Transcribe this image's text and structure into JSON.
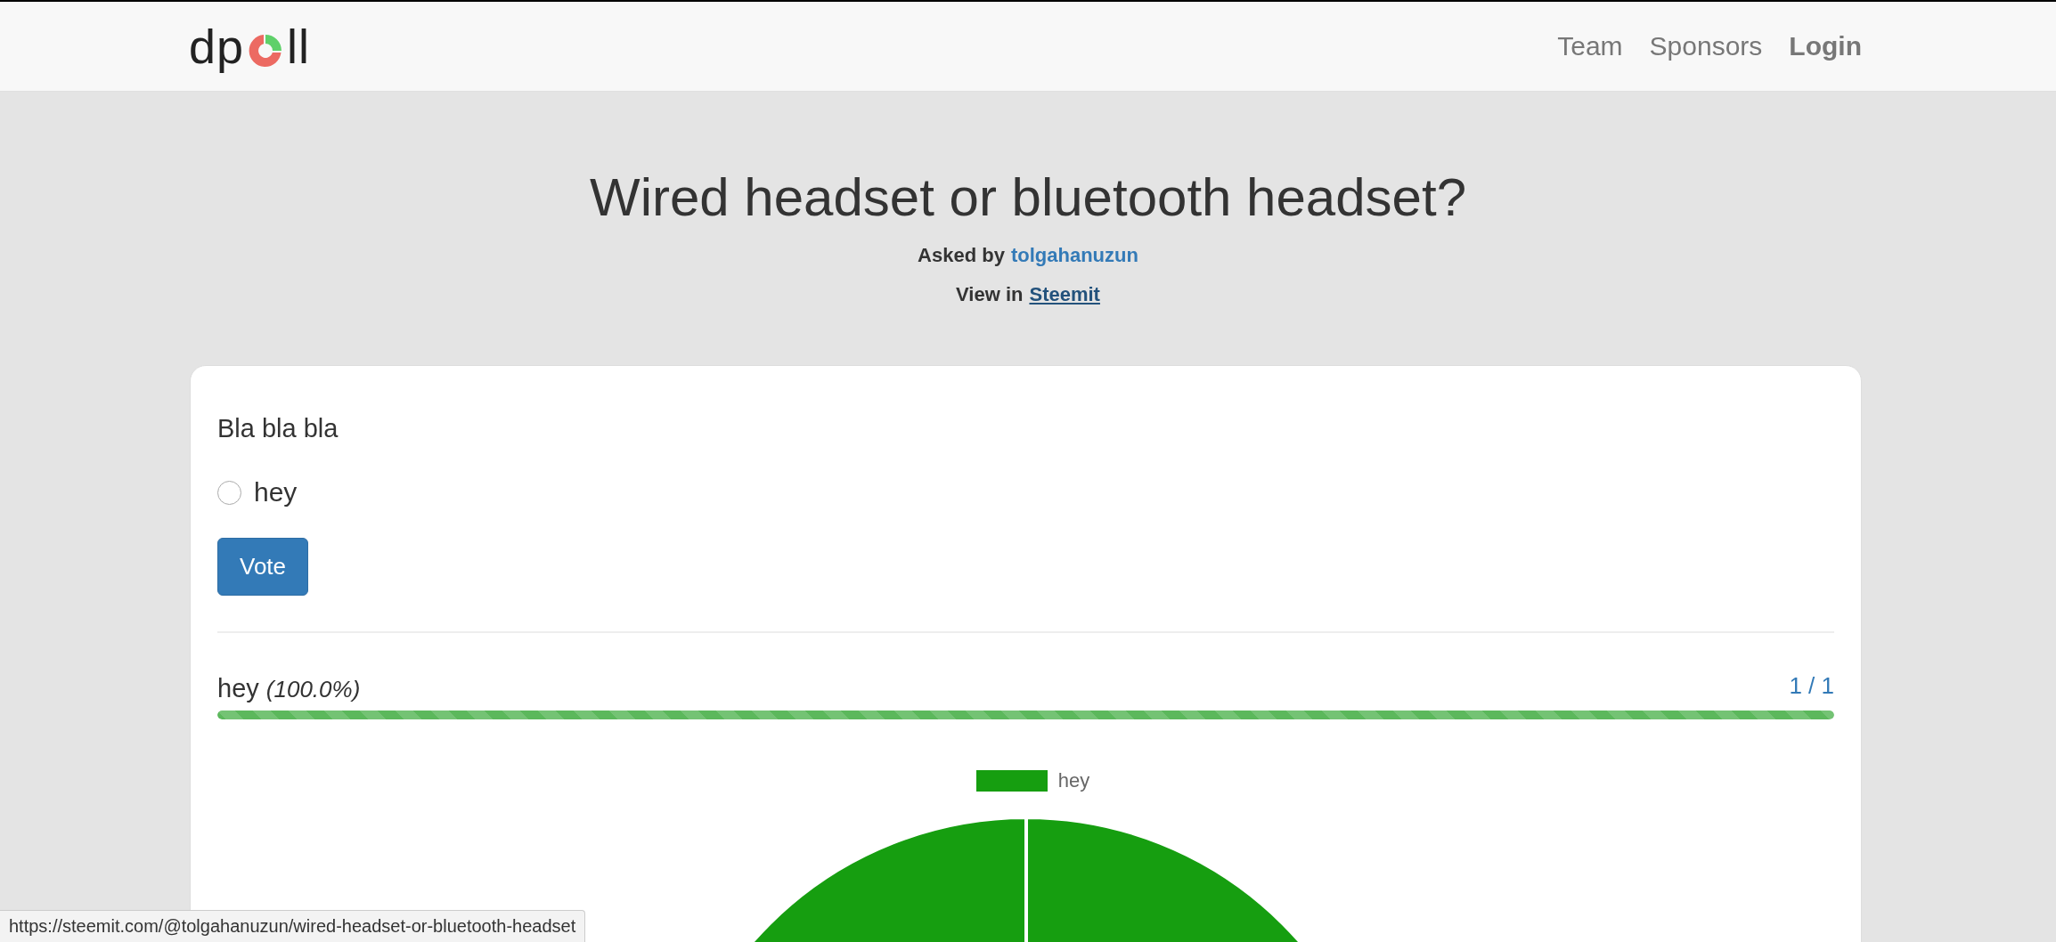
{
  "navbar": {
    "logo": {
      "text_start": "dp",
      "text_end": "ll"
    },
    "links": [
      {
        "label": "Team",
        "bold": false
      },
      {
        "label": "Sponsors",
        "bold": false
      },
      {
        "label": "Login",
        "bold": true
      }
    ]
  },
  "header": {
    "title": "Wired headset or bluetooth headset?",
    "asked_by_label": "Asked by",
    "author": "tolgahanuzun",
    "view_in_label": "View in",
    "view_link": "Steemit"
  },
  "poll": {
    "description": "Bla bla bla",
    "options": [
      {
        "label": "hey",
        "selected": false
      }
    ],
    "vote_button": "Vote",
    "results": [
      {
        "label": "hey",
        "percent": "(100.0%)",
        "count": "1 / 1",
        "level": 1.0
      }
    ],
    "pie_chart": {
      "legend": [
        {
          "label": "hey",
          "color": "#169e10"
        }
      ]
    }
  },
  "status_bar": {
    "url": "https://steemit.com/@tolgahanuzun/wired-headset-or-bluetooth-headset"
  }
}
